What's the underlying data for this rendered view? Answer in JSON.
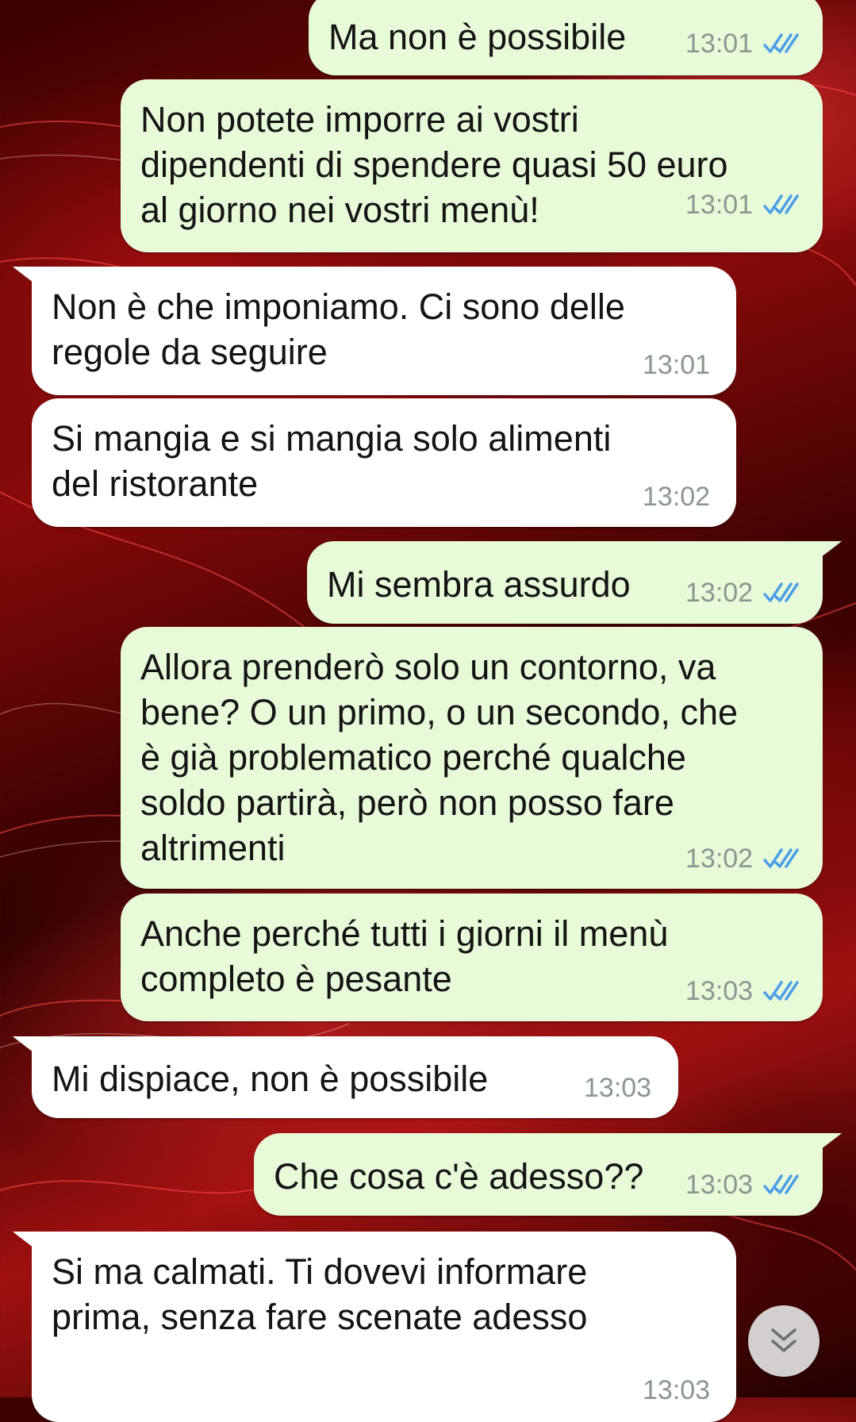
{
  "messages": [
    {
      "text": "Ma non è possibile",
      "time": "13:01",
      "direction": "outgoing",
      "status": "read-ticks-icon"
    },
    {
      "text": "Non potete imporre ai vostri\ndipendenti di spendere quasi 50 euro\nal giorno nei vostri menù!",
      "time": "13:01",
      "direction": "outgoing",
      "status": "read-ticks-icon"
    },
    {
      "text": "Non è che imponiamo. Ci sono delle\nregole da seguire",
      "time": "13:01",
      "direction": "incoming"
    },
    {
      "text": "Si mangia e si mangia solo alimenti\ndel ristorante",
      "time": "13:02",
      "direction": "incoming"
    },
    {
      "text": "Mi sembra assurdo",
      "time": "13:02",
      "direction": "outgoing",
      "status": "read-ticks-icon"
    },
    {
      "text": "Allora prenderò solo un contorno, va\nbene? O un primo, o un secondo, che\nè già problematico perché qualche\nsoldo partirà, però non posso fare\naltrimenti",
      "time": "13:02",
      "direction": "outgoing",
      "status": "read-ticks-icon"
    },
    {
      "text": "Anche perché tutti i giorni il menù\ncompleto è pesante",
      "time": "13:03",
      "direction": "outgoing",
      "status": "read-ticks-icon"
    },
    {
      "text": "Mi dispiace, non è possibile",
      "time": "13:03",
      "direction": "incoming"
    },
    {
      "text": "Che cosa c'è adesso??",
      "time": "13:03",
      "direction": "outgoing",
      "status": "read-ticks-icon"
    },
    {
      "text": "Si ma calmati. Ti dovevi informare\nprima, senza fare scenate adesso",
      "time": "13:03",
      "direction": "incoming"
    }
  ],
  "scroll_button_icon": "chevron-double-down-icon",
  "colors": {
    "outgoing_bubble": "#e8fbd9",
    "incoming_bubble": "#ffffff",
    "read_ticks": "#4a9fe8",
    "timestamp": "#8c958f"
  }
}
